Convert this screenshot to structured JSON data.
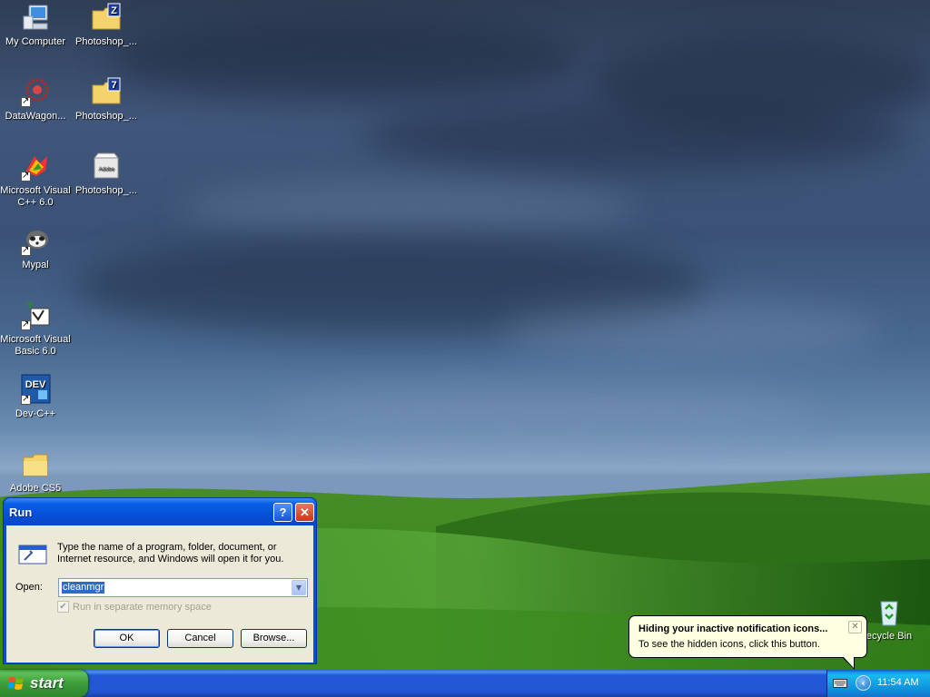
{
  "desktop": {
    "icons": [
      {
        "label": "My Computer",
        "icon": "computer-icon"
      },
      {
        "label": "Photoshop_...",
        "icon": "folder-zip-icon"
      },
      {
        "label": "DataWagon...",
        "icon": "datawagon-icon"
      },
      {
        "label": "Photoshop_...",
        "icon": "folder-7-icon"
      },
      {
        "label": "Microsoft Visual C++ 6.0",
        "icon": "visual-cpp-icon"
      },
      {
        "label": "Photoshop_...",
        "icon": "adobe-box-icon"
      },
      {
        "label": "Mypal",
        "icon": "mypal-icon"
      },
      {
        "label": "Microsoft Visual Basic 6.0",
        "icon": "visual-basic-icon"
      },
      {
        "label": "Dev-C++",
        "icon": "devcpp-icon"
      },
      {
        "label": "Adobe CS5",
        "icon": "folder-icon"
      }
    ],
    "recycle_bin": "ecycle Bin",
    "zip_badge": "Z",
    "seven_badge": "7",
    "adobe_text": "Adobe",
    "dev_text": "DEV"
  },
  "run_dialog": {
    "title": "Run",
    "help": "?",
    "close": "✕",
    "description": "Type the name of a program, folder, document, or Internet resource, and Windows will open it for you.",
    "open_label": "Open:",
    "open_value": "cleanmgr",
    "checkbox_label": "Run in separate memory space",
    "checkbox_checked": true,
    "ok": "OK",
    "cancel": "Cancel",
    "browse": "Browse..."
  },
  "balloon": {
    "title": "Hiding your inactive notification icons...",
    "text": "To see the hidden icons, click this button.",
    "close": "✕"
  },
  "taskbar": {
    "start": "start",
    "clock": "11:54 AM",
    "expand": "‹"
  },
  "colors": {
    "titlebar": "#0a5fe6",
    "start_green": "#3c9c3a",
    "tray_blue": "#139ee9",
    "balloon_bg": "#ffffe1",
    "dialog_bg": "#ece9d8"
  }
}
